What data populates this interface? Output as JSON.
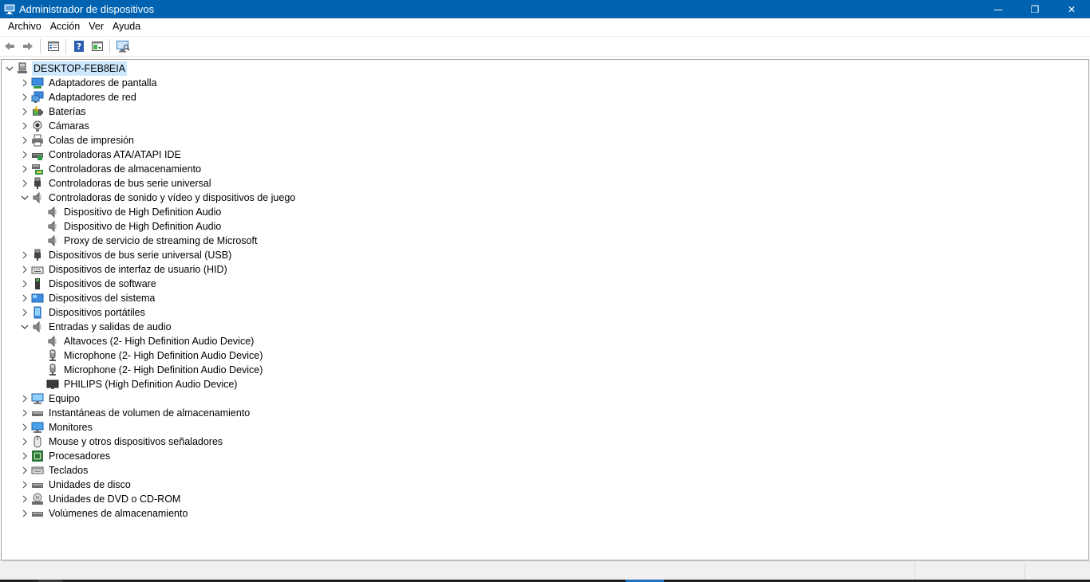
{
  "window": {
    "title": "Administrador de dispositivos",
    "controls": {
      "minimize": "—",
      "restore": "❐",
      "close": "✕"
    }
  },
  "menu": [
    "Archivo",
    "Acción",
    "Ver",
    "Ayuda"
  ],
  "toolbar": [
    "back-arrow-icon",
    "forward-arrow-icon",
    "properties-icon",
    "help-icon",
    "update-driver-icon",
    "scan-hardware-icon"
  ],
  "tree": {
    "root": "DESKTOP-FEB8EIA",
    "items": [
      {
        "label": "Adaptadores de pantalla",
        "icon": "display-adapter-icon",
        "expanded": false
      },
      {
        "label": "Adaptadores de red",
        "icon": "network-adapter-icon",
        "expanded": false
      },
      {
        "label": "Baterías",
        "icon": "battery-icon",
        "expanded": false
      },
      {
        "label": "Cámaras",
        "icon": "camera-icon",
        "expanded": false
      },
      {
        "label": "Colas de impresión",
        "icon": "printer-icon",
        "expanded": false
      },
      {
        "label": "Controladoras ATA/ATAPI IDE",
        "icon": "ide-controller-icon",
        "expanded": false
      },
      {
        "label": "Controladoras de almacenamiento",
        "icon": "storage-controller-icon",
        "expanded": false
      },
      {
        "label": "Controladoras de bus serie universal",
        "icon": "usb-icon",
        "expanded": false
      },
      {
        "label": "Controladoras de sonido y vídeo y dispositivos de juego",
        "icon": "speaker-icon",
        "expanded": true,
        "children": [
          {
            "label": "Dispositivo de High Definition Audio",
            "icon": "speaker-icon"
          },
          {
            "label": "Dispositivo de High Definition Audio",
            "icon": "speaker-icon"
          },
          {
            "label": "Proxy de servicio de streaming de Microsoft",
            "icon": "speaker-icon"
          }
        ]
      },
      {
        "label": "Dispositivos de bus serie universal (USB)",
        "icon": "usb-icon",
        "expanded": false
      },
      {
        "label": "Dispositivos de interfaz de usuario (HID)",
        "icon": "hid-icon",
        "expanded": false
      },
      {
        "label": "Dispositivos de software",
        "icon": "software-device-icon",
        "expanded": false
      },
      {
        "label": "Dispositivos del sistema",
        "icon": "system-device-icon",
        "expanded": false
      },
      {
        "label": "Dispositivos portátiles",
        "icon": "portable-device-icon",
        "expanded": false
      },
      {
        "label": "Entradas y salidas de audio",
        "icon": "speaker-icon",
        "expanded": true,
        "children": [
          {
            "label": "Altavoces (2- High Definition Audio Device)",
            "icon": "speaker-icon"
          },
          {
            "label": "Microphone (2- High Definition Audio Device)",
            "icon": "microphone-icon"
          },
          {
            "label": "Microphone (2- High Definition Audio Device)",
            "icon": "microphone-icon"
          },
          {
            "label": "PHILIPS (High Definition Audio Device)",
            "icon": "monitor-dark-icon"
          }
        ]
      },
      {
        "label": "Equipo",
        "icon": "computer-icon",
        "expanded": false
      },
      {
        "label": "Instantáneas de volumen de almacenamiento",
        "icon": "disk-drive-icon",
        "expanded": false
      },
      {
        "label": "Monitores",
        "icon": "monitor-icon",
        "expanded": false
      },
      {
        "label": "Mouse y otros dispositivos señaladores",
        "icon": "mouse-icon",
        "expanded": false
      },
      {
        "label": "Procesadores",
        "icon": "processor-icon",
        "expanded": false
      },
      {
        "label": "Teclados",
        "icon": "keyboard-icon",
        "expanded": false
      },
      {
        "label": "Unidades de disco",
        "icon": "disk-drive-icon",
        "expanded": false
      },
      {
        "label": "Unidades de DVD o CD-ROM",
        "icon": "dvd-icon",
        "expanded": false
      },
      {
        "label": "Volúmenes de almacenamiento",
        "icon": "disk-drive-icon",
        "expanded": false
      }
    ]
  },
  "colors": {
    "titlebar": "#0063b1",
    "selection": "#cce8ff",
    "statusbar": "#f0f0f0"
  }
}
